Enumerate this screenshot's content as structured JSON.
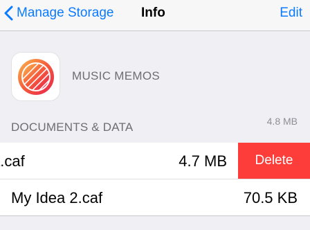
{
  "nav": {
    "back_label": "Manage Storage",
    "title": "Info",
    "edit_label": "Edit"
  },
  "app": {
    "name": "MUSIC MEMOS",
    "icon": "music-memos-icon"
  },
  "section": {
    "header": "DOCUMENTS & DATA",
    "total_size": "4.8 MB"
  },
  "files": [
    {
      "name": "My Idea.caf",
      "visible_name": "a.caf",
      "size": "4.7 MB",
      "swiped": true
    },
    {
      "name": "My Idea 2.caf",
      "size": "70.5 KB",
      "swiped": false
    }
  ],
  "actions": {
    "delete_label": "Delete"
  },
  "colors": {
    "tint": "#0a7aff",
    "delete": "#fc3d39",
    "background": "#efeff4",
    "secondary_text": "#6d6d72"
  }
}
